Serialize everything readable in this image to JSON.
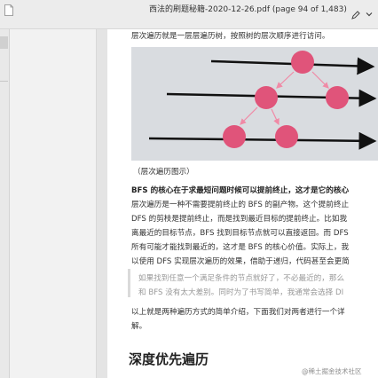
{
  "window": {
    "title": "西法的刷题秘籍-2020-12-26.pdf (page 94 of 1,483)"
  },
  "toolbar": {
    "annotate_icon": "pen-icon",
    "dropdown_icon": "chevron-down-icon"
  },
  "page": {
    "intro": "层次遍历就是一层层遍历树，按照树的层次顺序进行访问。",
    "caption": "（层次遍历图示）",
    "para1": [
      "BFS 的核心在于求最短问题时候可以提前终止，这才是它的核心",
      "层次遍历是一种不需要提前终止的 BFS 的副产物。这个提前终止",
      "DFS 的剪枝是提前终止，而是找到最近目标的提前终止。比如我",
      "离最近的目标节点，BFS 找到目标节点就可以直接返回。而 DFS",
      "所有可能才能找到最近的，这才是 BFS 的核心价值。实际上，我",
      "以使用 DFS 实现层次遍历的效果，借助于递归，代码甚至会更简"
    ],
    "quote": [
      "如果找到任意一个满足条件的节点就好了，不必最近的，那么",
      "和 BFS 没有太大差别。同时为了书写简单，我通常会选择 DI"
    ],
    "para2": [
      "以上就是两种遍历方式的简单介绍，下面我们对两者进行一个详",
      "解。"
    ],
    "heading": "深度优先遍历"
  },
  "watermark": "@稀土掘金技术社区",
  "colors": {
    "node": "#e0547a",
    "edge": "#f08aa6",
    "arrow": "#111111",
    "illustration_bg": "#d9dce0"
  }
}
